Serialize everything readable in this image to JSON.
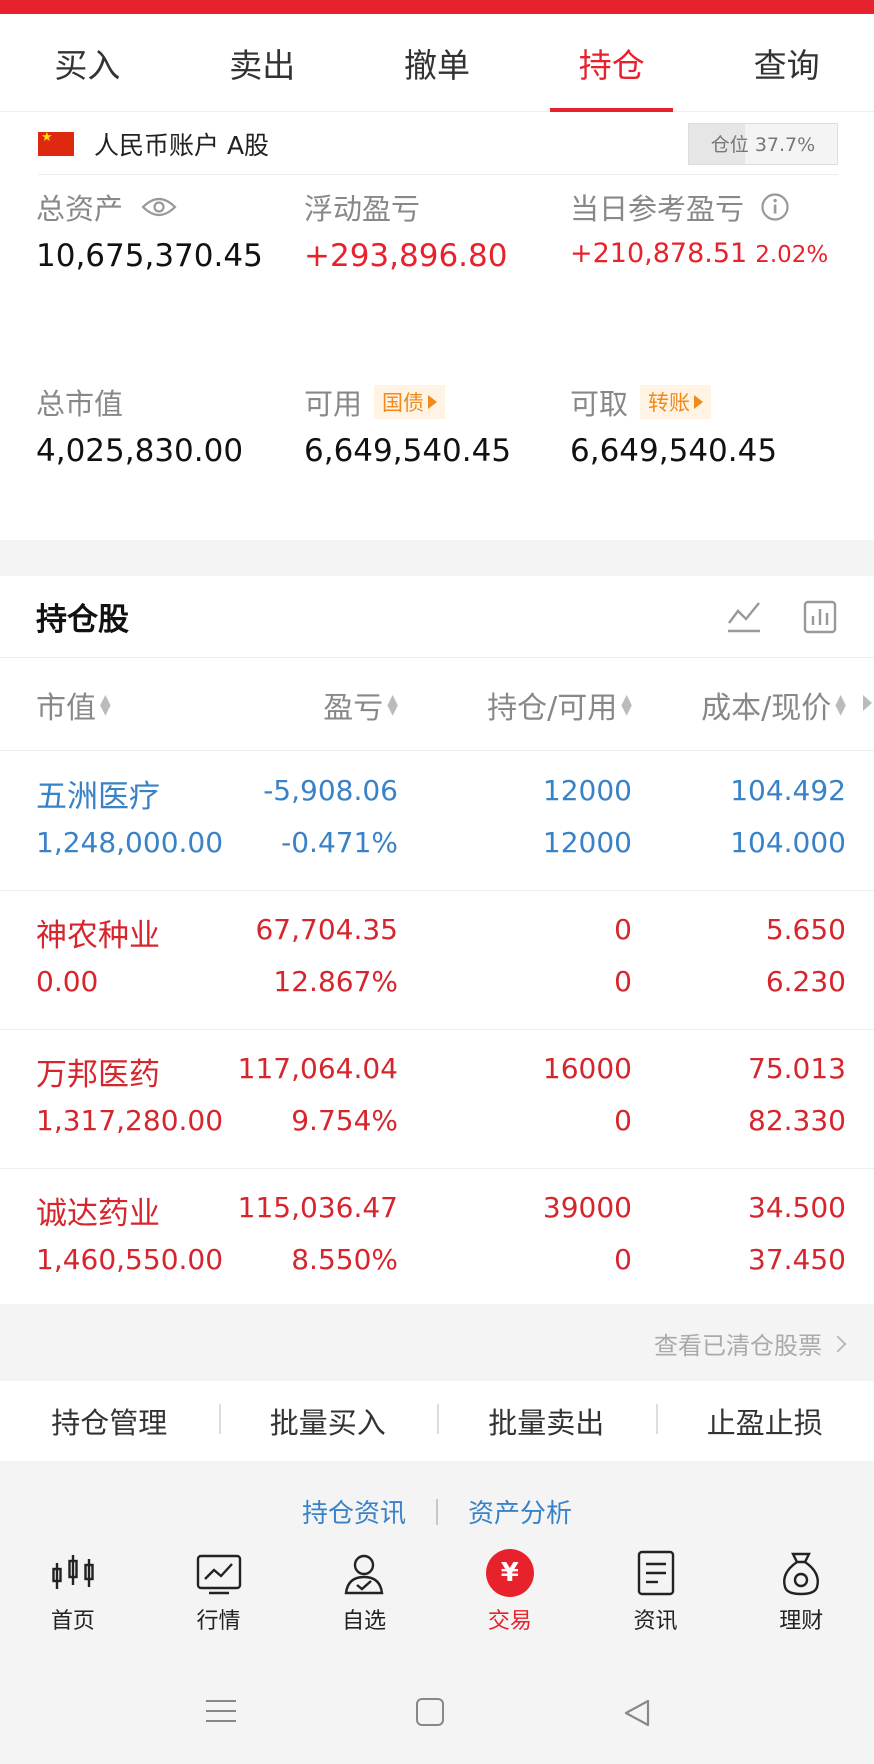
{
  "tabs": [
    {
      "label": "买入"
    },
    {
      "label": "卖出"
    },
    {
      "label": "撤单"
    },
    {
      "label": "持仓",
      "active": true
    },
    {
      "label": "查询"
    }
  ],
  "account": {
    "name": "人民币账户 A股",
    "position_label": "仓位 37.7%",
    "position_ratio": 0.377
  },
  "summary": {
    "total_assets_label": "总资产",
    "total_assets": "10,675,370.45",
    "floating_pl_label": "浮动盈亏",
    "floating_pl": "+293,896.80",
    "daily_pl_label": "当日参考盈亏",
    "daily_pl": "+210,878.51",
    "daily_pl_pct": "2.02%",
    "market_value_label": "总市值",
    "market_value": "4,025,830.00",
    "available_label": "可用",
    "available_tag": "国债",
    "available": "6,649,540.45",
    "withdrawable_label": "可取",
    "withdrawable_tag": "转账",
    "withdrawable": "6,649,540.45"
  },
  "holdings": {
    "title": "持仓股",
    "columns": [
      "市值",
      "盈亏",
      "持仓/可用",
      "成本/现价"
    ],
    "rows": [
      {
        "name": "五洲医疗",
        "market_value": "1,248,000.00",
        "pl": "-5,908.06",
        "pl_pct": "-0.471%",
        "holding": "12000",
        "available": "12000",
        "cost": "104.492",
        "price": "104.000",
        "color": "#3a82c8"
      },
      {
        "name": "神农种业",
        "market_value": "0.00",
        "pl": "67,704.35",
        "pl_pct": "12.867%",
        "holding": "0",
        "available": "0",
        "cost": "5.650",
        "price": "6.230",
        "color": "#d6262d"
      },
      {
        "name": "万邦医药",
        "market_value": "1,317,280.00",
        "pl": "117,064.04",
        "pl_pct": "9.754%",
        "holding": "16000",
        "available": "0",
        "cost": "75.013",
        "price": "82.330",
        "color": "#d6262d"
      },
      {
        "name": "诚达药业",
        "market_value": "1,460,550.00",
        "pl": "115,036.47",
        "pl_pct": "8.550%",
        "holding": "39000",
        "available": "0",
        "cost": "34.500",
        "price": "37.450",
        "color": "#d6262d"
      }
    ],
    "cleared_link": "查看已清仓股票"
  },
  "actions": [
    "持仓管理",
    "批量买入",
    "批量卖出",
    "止盈止损"
  ],
  "links": [
    "持仓资讯",
    "资产分析"
  ],
  "nav": [
    {
      "label": "首页",
      "icon": "candlestick-icon"
    },
    {
      "label": "行情",
      "icon": "chart-line-icon"
    },
    {
      "label": "自选",
      "icon": "user-check-icon"
    },
    {
      "label": "交易",
      "icon": "yuan-icon",
      "active": true
    },
    {
      "label": "资讯",
      "icon": "document-icon"
    },
    {
      "label": "理财",
      "icon": "money-bag-icon"
    }
  ],
  "colors": {
    "accent": "#e8222c",
    "up": "#d6262d",
    "down": "#3a82c8",
    "tag": "#f08a1d"
  }
}
